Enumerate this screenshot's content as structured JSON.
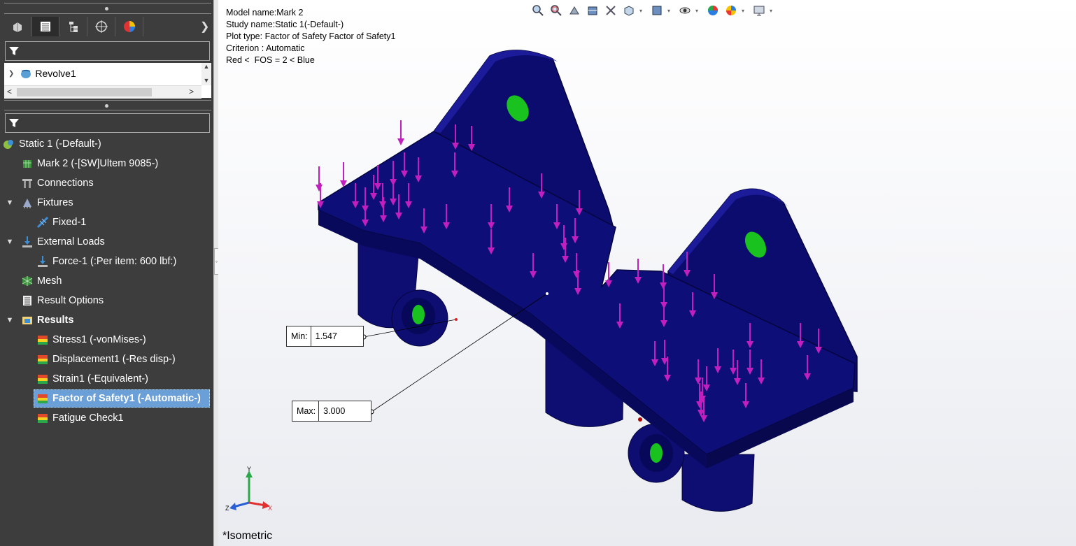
{
  "part_tree": {
    "item": "Revolve1"
  },
  "study_tree": [
    {
      "label": "Static 1 (-Default-)",
      "icon": "study-icon"
    },
    {
      "label": "Mark 2 (-[SW]Ultem 9085-)",
      "icon": "part-icon"
    },
    {
      "label": "Connections",
      "icon": "connections-icon"
    },
    {
      "label": "Fixtures",
      "icon": "fixtures-icon"
    },
    {
      "label": "Fixed-1",
      "icon": "fixed-icon"
    },
    {
      "label": "External Loads",
      "icon": "external-loads-icon"
    },
    {
      "label": "Force-1 (:Per item: 600 lbf:)",
      "icon": "force-icon"
    },
    {
      "label": "Mesh",
      "icon": "mesh-icon"
    },
    {
      "label": "Result Options",
      "icon": "result-options-icon"
    },
    {
      "label": "Results",
      "icon": "results-folder-icon"
    },
    {
      "label": "Stress1 (-vonMises-)",
      "icon": "plot-icon"
    },
    {
      "label": "Displacement1 (-Res disp-)",
      "icon": "plot-icon"
    },
    {
      "label": "Strain1 (-Equivalent-)",
      "icon": "plot-icon"
    },
    {
      "label": "Factor of Safety1 (-Automatic-)",
      "icon": "plot-icon"
    },
    {
      "label": "Fatigue Check1",
      "icon": "fatigue-icon"
    }
  ],
  "plot_info": {
    "model_name": "Model name:Mark 2",
    "study_name": "Study name:Static 1(-Default-)",
    "plot_type": "Plot type: Factor of Safety Factor of Safety1",
    "criterion": "Criterion : Automatic",
    "legend": "Red <  FOS = 2 < Blue"
  },
  "min_callout": {
    "label": "Min:",
    "value": "1.547"
  },
  "max_callout": {
    "label": "Max:",
    "value": "3.000"
  },
  "view_name": "*Isometric",
  "triad": {
    "y": "Y",
    "x": "X",
    "z": "Z"
  },
  "colors": {
    "model": "#0c0c6e",
    "model_light": "#1c1c9a",
    "load_arrow": "#c21fbf",
    "fixture": "#19c21f",
    "selection": "#6a9fd8"
  }
}
